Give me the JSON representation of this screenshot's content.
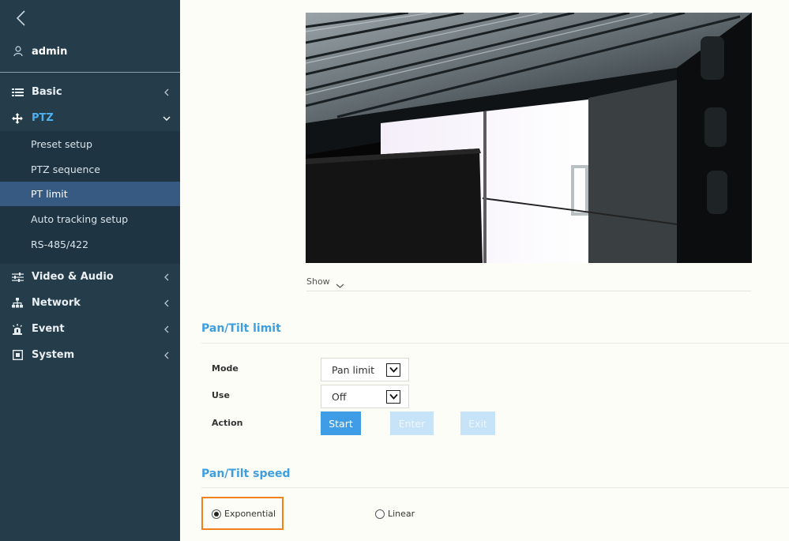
{
  "user": {
    "name": "admin"
  },
  "menu": {
    "basic": "Basic",
    "ptz": "PTZ",
    "ptz_sub": [
      "Preset setup",
      "PTZ sequence",
      "PT limit",
      "Auto tracking setup",
      "RS-485/422"
    ],
    "video_audio": "Video & Audio",
    "network": "Network",
    "event": "Event",
    "system": "System"
  },
  "video": {
    "show_label": "Show"
  },
  "pan_tilt_limit": {
    "title": "Pan/Tilt limit",
    "mode_label": "Mode",
    "mode_value": "Pan limit",
    "use_label": "Use",
    "use_value": "Off",
    "action_label": "Action",
    "start": "Start",
    "enter": "Enter",
    "exit": "Exit"
  },
  "pan_tilt_speed": {
    "title": "Pan/Tilt speed",
    "exponential": "Exponential",
    "linear": "Linear",
    "selected": "Exponential"
  },
  "colors": {
    "sidebar": "#253d4b",
    "submenu": "#1e3442",
    "selected_item": "#375a83",
    "accent": "#3e9de5",
    "highlight": "#f0821e"
  }
}
